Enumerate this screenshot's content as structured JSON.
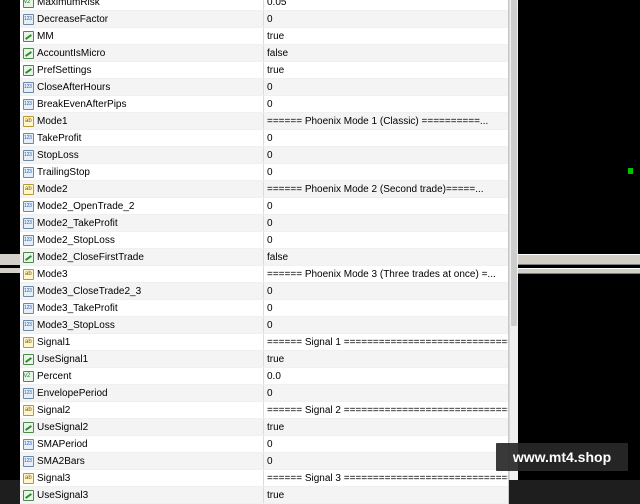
{
  "parameters": [
    {
      "name": "MaximumRisk",
      "value": "0.05",
      "type": "dbl"
    },
    {
      "name": "DecreaseFactor",
      "value": "0",
      "type": "num"
    },
    {
      "name": "MM",
      "value": "true",
      "type": "bool"
    },
    {
      "name": "AccountIsMicro",
      "value": "false",
      "type": "bool"
    },
    {
      "name": "PrefSettings",
      "value": "true",
      "type": "bool"
    },
    {
      "name": "CloseAfterHours",
      "value": "0",
      "type": "num"
    },
    {
      "name": "BreakEvenAfterPips",
      "value": "0",
      "type": "num"
    },
    {
      "name": "Mode1",
      "value": "====== Phoenix Mode 1 (Classic) ==========...",
      "type": "str"
    },
    {
      "name": "TakeProfit",
      "value": "0",
      "type": "num"
    },
    {
      "name": "StopLoss",
      "value": "0",
      "type": "num"
    },
    {
      "name": "TrailingStop",
      "value": "0",
      "type": "num"
    },
    {
      "name": "Mode2",
      "value": "====== Phoenix Mode 2 (Second trade)=====...",
      "type": "str"
    },
    {
      "name": "Mode2_OpenTrade_2",
      "value": "0",
      "type": "num"
    },
    {
      "name": "Mode2_TakeProfit",
      "value": "0",
      "type": "num"
    },
    {
      "name": "Mode2_StopLoss",
      "value": "0",
      "type": "num"
    },
    {
      "name": "Mode2_CloseFirstTrade",
      "value": "false",
      "type": "bool"
    },
    {
      "name": "Mode3",
      "value": "====== Phoenix Mode 3 (Three trades at once) =...",
      "type": "str"
    },
    {
      "name": "Mode3_CloseTrade2_3",
      "value": "0",
      "type": "num"
    },
    {
      "name": "Mode3_TakeProfit",
      "value": "0",
      "type": "num"
    },
    {
      "name": "Mode3_StopLoss",
      "value": "0",
      "type": "num"
    },
    {
      "name": "Signal1",
      "value": "====== Signal 1 =============================",
      "type": "str"
    },
    {
      "name": "UseSignal1",
      "value": "true",
      "type": "bool"
    },
    {
      "name": "Percent",
      "value": "0.0",
      "type": "dbl"
    },
    {
      "name": "EnvelopePeriod",
      "value": "0",
      "type": "num"
    },
    {
      "name": "Signal2",
      "value": "====== Signal 2 =============================",
      "type": "str"
    },
    {
      "name": "UseSignal2",
      "value": "true",
      "type": "bool"
    },
    {
      "name": "SMAPeriod",
      "value": "0",
      "type": "num"
    },
    {
      "name": "SMA2Bars",
      "value": "0",
      "type": "num"
    },
    {
      "name": "Signal3",
      "value": "====== Signal 3 =============================",
      "type": "str"
    },
    {
      "name": "UseSignal3",
      "value": "true",
      "type": "bool"
    }
  ],
  "watermark": "www.mt4.shop",
  "colors": {
    "background": "#000000",
    "table": "#ffffff",
    "alt_row": "#f4f4f4",
    "chart_green": "#00c000"
  }
}
